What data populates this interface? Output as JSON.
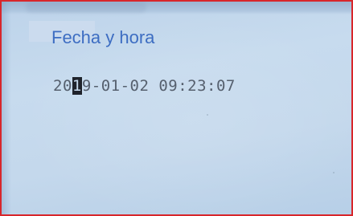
{
  "screen": {
    "label": "Fecha y hora",
    "datetime": {
      "before_cursor": "20",
      "cursor_char": "1",
      "after_cursor": "9-01-02 09:23:07"
    }
  },
  "colors": {
    "frame_border": "#d8262b",
    "label_text": "#3d6dc2",
    "lcd_text": "#56606e",
    "lcd_background": "#c4d8ec"
  }
}
